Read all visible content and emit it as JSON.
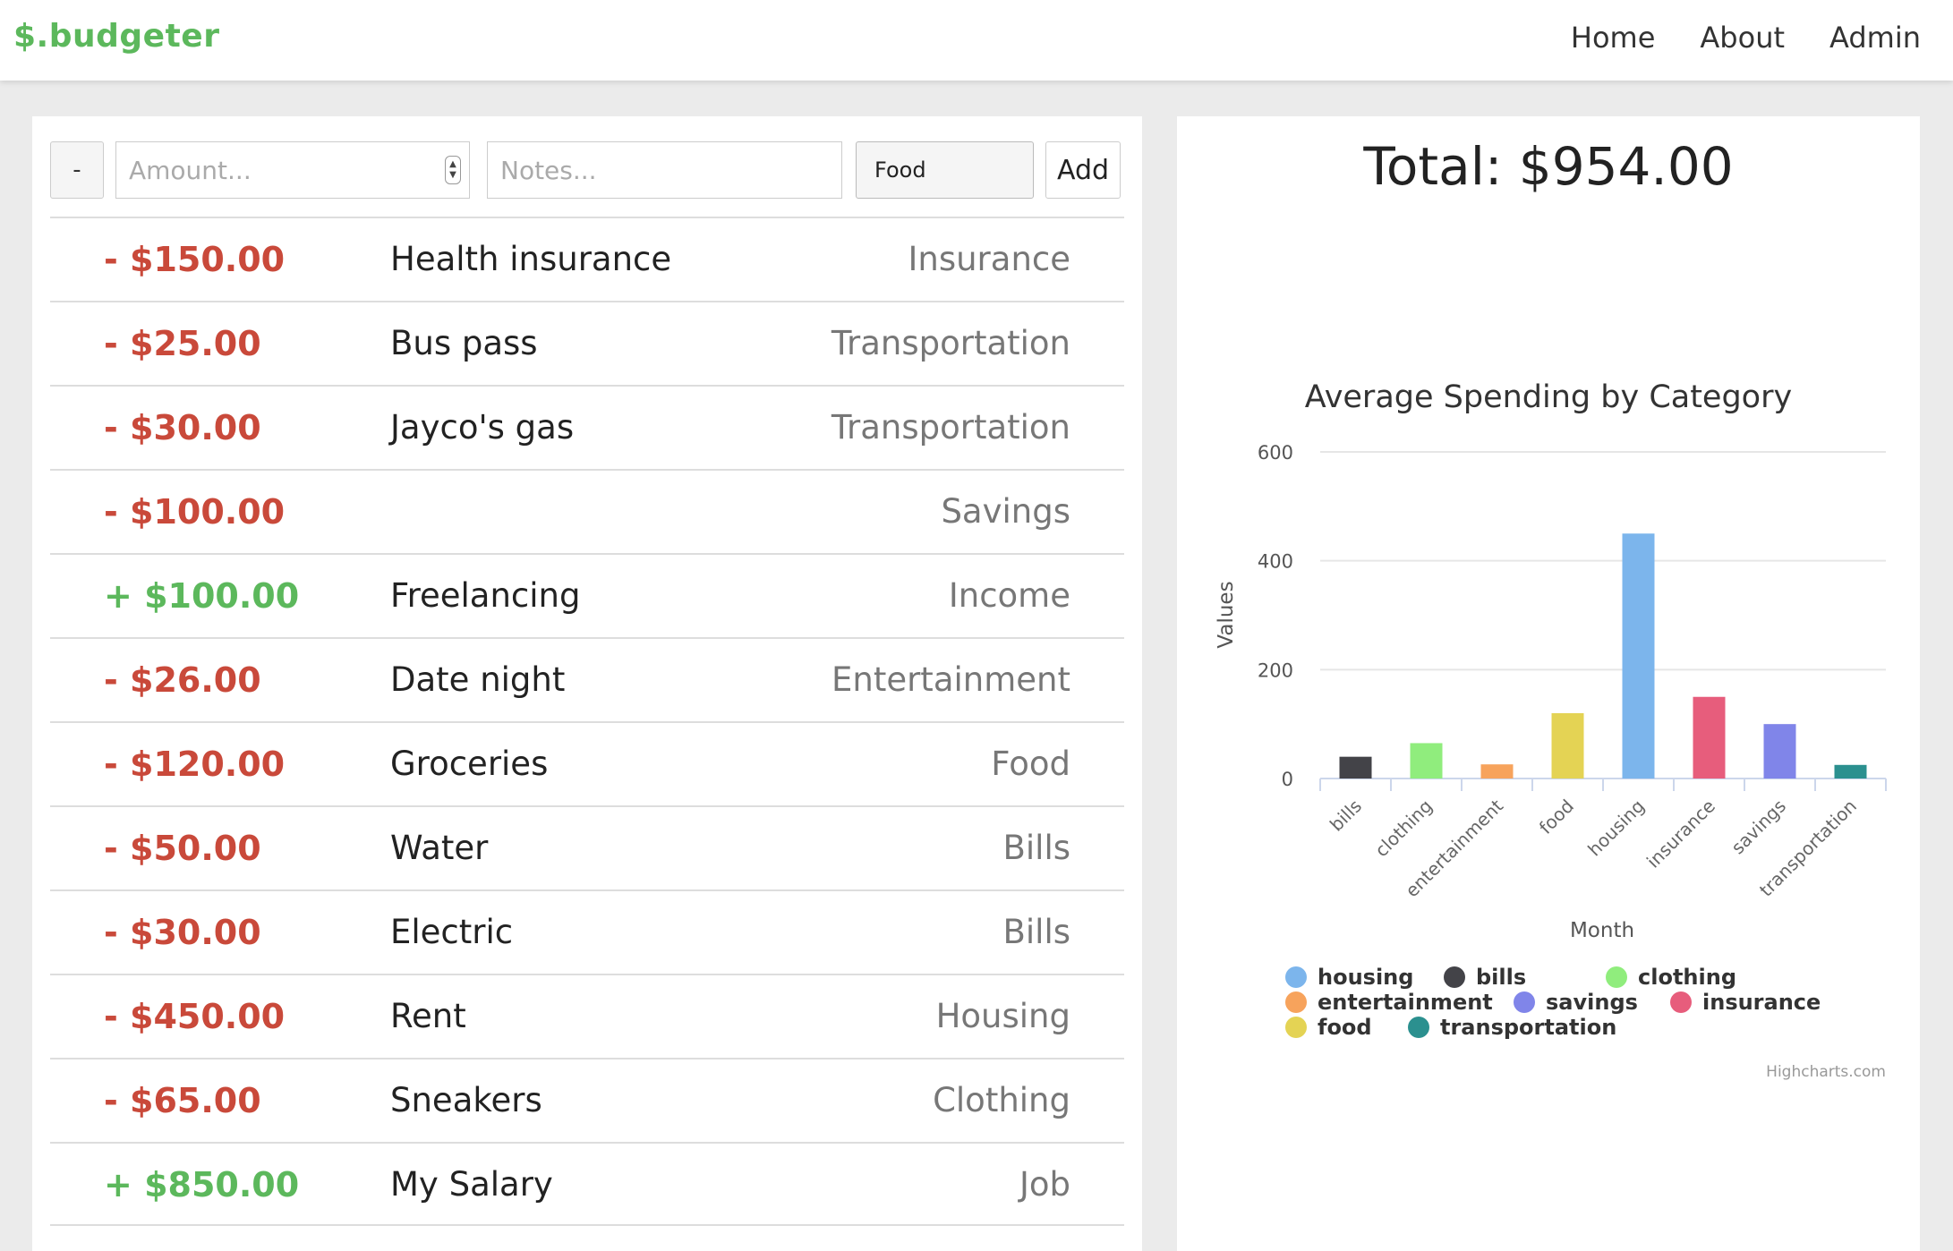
{
  "navbar": {
    "brand": "$.budgeter",
    "links": [
      "Home",
      "About",
      "Admin"
    ]
  },
  "form": {
    "sign_label": "-",
    "amount_placeholder": "Amount...",
    "notes_placeholder": "Notes...",
    "category_value": "Food",
    "add_label": "Add"
  },
  "transactions": [
    {
      "amount": "- $150.00",
      "type": "negative",
      "note": "Health insurance",
      "category": "Insurance"
    },
    {
      "amount": "- $25.00",
      "type": "negative",
      "note": "Bus pass",
      "category": "Transportation"
    },
    {
      "amount": "- $30.00",
      "type": "negative",
      "note": "Jayco's gas",
      "category": "Transportation"
    },
    {
      "amount": "- $100.00",
      "type": "negative",
      "note": "",
      "category": "Savings"
    },
    {
      "amount": "+ $100.00",
      "type": "positive",
      "note": "Freelancing",
      "category": "Income"
    },
    {
      "amount": "- $26.00",
      "type": "negative",
      "note": "Date night",
      "category": "Entertainment"
    },
    {
      "amount": "- $120.00",
      "type": "negative",
      "note": "Groceries",
      "category": "Food"
    },
    {
      "amount": "- $50.00",
      "type": "negative",
      "note": "Water",
      "category": "Bills"
    },
    {
      "amount": "- $30.00",
      "type": "negative",
      "note": "Electric",
      "category": "Bills"
    },
    {
      "amount": "- $450.00",
      "type": "negative",
      "note": "Rent",
      "category": "Housing"
    },
    {
      "amount": "- $65.00",
      "type": "negative",
      "note": "Sneakers",
      "category": "Clothing"
    },
    {
      "amount": "+ $850.00",
      "type": "positive",
      "note": "My Salary",
      "category": "Job"
    }
  ],
  "summary": {
    "total": "Total: $954.00"
  },
  "colors": {
    "negative": "#c9493a",
    "positive": "#5cb85c"
  },
  "chart_data": {
    "type": "bar",
    "title": "Average Spending by Category",
    "xlabel": "Month",
    "ylabel": "Values",
    "ylim": [
      0,
      600
    ],
    "yticks": [
      0,
      200,
      400,
      600
    ],
    "categories": [
      "bills",
      "clothing",
      "entertainment",
      "food",
      "housing",
      "insurance",
      "savings",
      "transportation"
    ],
    "values": [
      40,
      65,
      26,
      120,
      450,
      150,
      100,
      25
    ],
    "bar_colors": [
      "#434348",
      "#90ed7d",
      "#f7a35c",
      "#e4d354",
      "#7cb5ec",
      "#e75d7c",
      "#8085e9",
      "#2b908f"
    ],
    "legend": [
      {
        "name": "housing",
        "color": "#7cb5ec"
      },
      {
        "name": "bills",
        "color": "#434348"
      },
      {
        "name": "clothing",
        "color": "#90ed7d"
      },
      {
        "name": "entertainment",
        "color": "#f7a35c"
      },
      {
        "name": "savings",
        "color": "#8085e9"
      },
      {
        "name": "insurance",
        "color": "#e75d7c"
      },
      {
        "name": "food",
        "color": "#e4d354"
      },
      {
        "name": "transportation",
        "color": "#2b908f"
      }
    ],
    "credits": "Highcharts.com",
    "grid": true,
    "legend_position": "bottom"
  }
}
